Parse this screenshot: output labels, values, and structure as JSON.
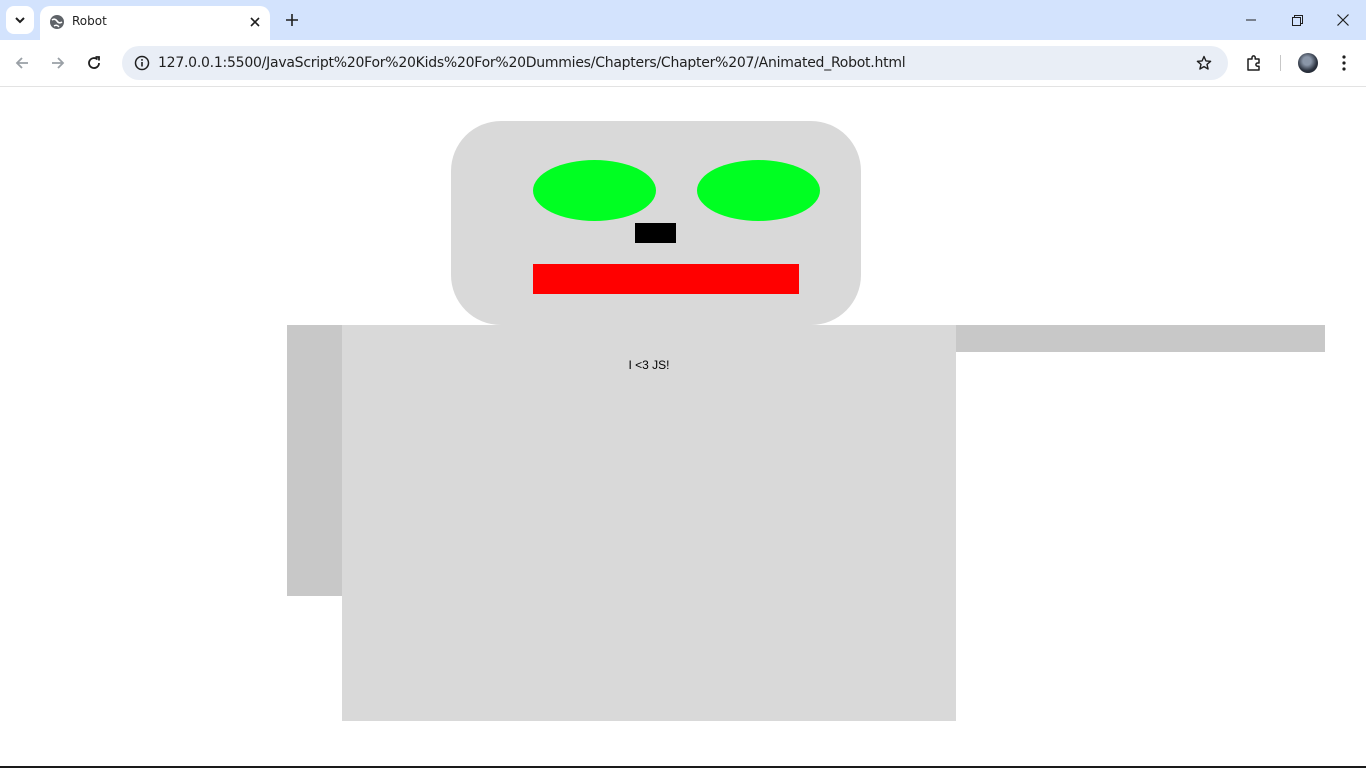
{
  "browser": {
    "tab_title": "Robot",
    "url": "127.0.0.1:5500/JavaScript%20For%20Kids%20For%20Dummies/Chapters/Chapter%207/Animated_Robot.html",
    "icons": {
      "tab_search": "chevron-down-icon",
      "favicon": "globe-icon",
      "tab_close": "close-icon",
      "new_tab": "plus-icon",
      "minimize": "minimize-icon",
      "restore": "restore-icon",
      "close_window": "close-icon",
      "back": "back-arrow-icon",
      "forward": "forward-arrow-icon",
      "reload": "reload-icon",
      "site_info": "info-icon",
      "bookmark": "star-icon",
      "extensions": "puzzle-icon",
      "menu": "kebab-menu-icon"
    }
  },
  "robot": {
    "body_text": "I <3 JS!",
    "colors": {
      "head": "#d9d9d9",
      "body": "#d9d9d9",
      "arms": "#c8c8c8",
      "eyes": "#00ff22",
      "nose": "#000000",
      "mouth": "#ff0000"
    }
  }
}
